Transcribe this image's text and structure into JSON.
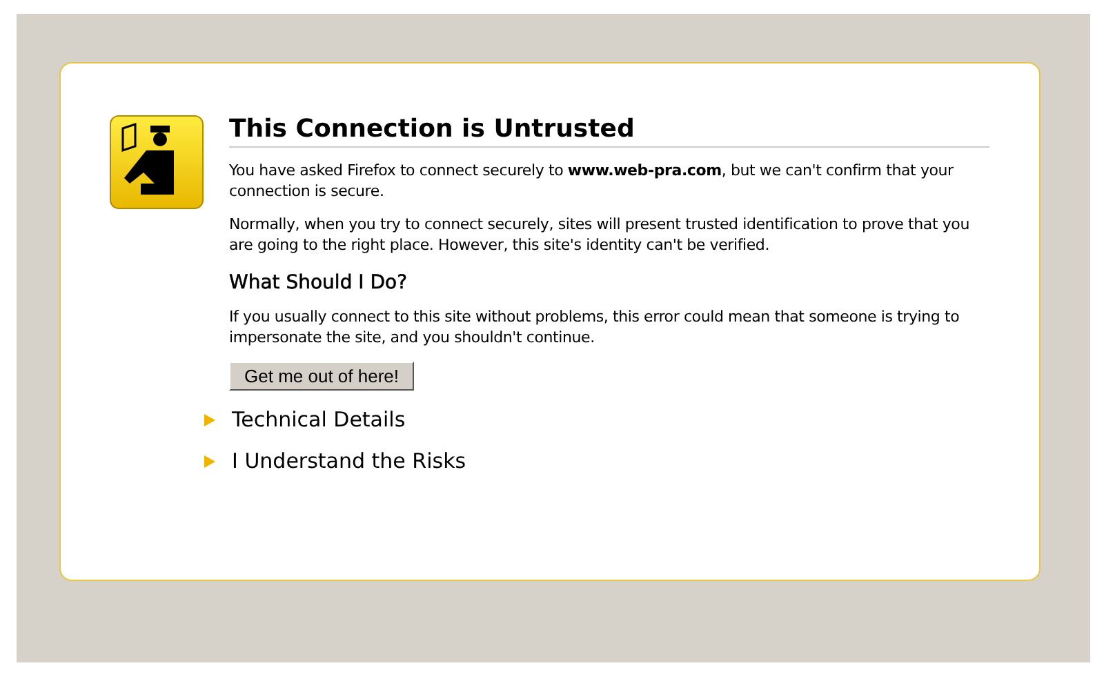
{
  "title": "This Connection is Untrusted",
  "paragraphs": [
    "You have asked Firefox to connect securely to **www.web-pra.com**, but we can't confirm that your connection is secure.",
    "Normally, when you try to connect securely, sites will present trusted identification to prove that you are going to the right place. However, this site's identity can't be verified."
  ],
  "subtitle": "What Should I Do?",
  "advice": "If you usually connect to this site without problems, this error could mean that someone is trying to impersonate the site, and you shouldn't continue.",
  "button": "Get me out of here!",
  "expanders": [
    {
      "label": "Technical Details",
      "expanded": false
    },
    {
      "label": "I Understand the Risks",
      "expanded": false
    }
  ]
}
